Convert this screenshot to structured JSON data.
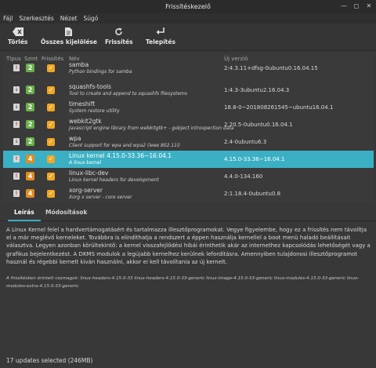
{
  "window": {
    "title": "Frissítéskezelő"
  },
  "menu": [
    "Fájl",
    "Szerkesztés",
    "Nézet",
    "Súgó"
  ],
  "toolbar": {
    "clear": "Törlés",
    "select_all": "Összes kijelölése",
    "refresh": "Frissítés",
    "install": "Telepítés"
  },
  "table": {
    "headers": {
      "type": "Típus",
      "level": "Szint",
      "update": "Frissítés",
      "name": "Név",
      "new_version": "Új verzió"
    },
    "rows": [
      {
        "type": "security",
        "level": "2",
        "checked": true,
        "name": "samba",
        "desc": "Python bindings for samba",
        "version": "2:4.3.11+dfsg-0ubuntu0.16.04.15",
        "selected": false
      },
      {
        "type": "package",
        "level": "2",
        "checked": true,
        "name": "squashfs-tools",
        "desc": "Tool to create and append to squashfs filesystems",
        "version": "1:4.3-3ubuntu2.16.04.3",
        "selected": false
      },
      {
        "type": "package",
        "level": "2",
        "checked": true,
        "name": "timeshift",
        "desc": "System restore utility",
        "version": "18.8-0~201808261545~ubuntu16.04.1",
        "selected": false
      },
      {
        "type": "security",
        "level": "2",
        "checked": true,
        "name": "webkit2gtk",
        "desc": "Javascript engine library from webkitgtk+ - gobject introspection data",
        "version": "2.20.5-0ubuntu0.16.04.1",
        "selected": false
      },
      {
        "type": "package",
        "level": "2",
        "checked": true,
        "name": "wpa",
        "desc": "Client support for wpa and wpa2 (ieee 802.11i)",
        "version": "2.4-0ubuntu6.3",
        "selected": false
      },
      {
        "type": "security",
        "level": "4",
        "checked": true,
        "name": "Linux kernel 4.15.0-33.36~16.04.1",
        "desc": "A linux kernel",
        "version": "4.15.0-33.36~16.04.1",
        "selected": true
      },
      {
        "type": "security",
        "level": "4",
        "checked": true,
        "name": "linux-libc-dev",
        "desc": "Linux kernel headers for development",
        "version": "4.4.0-134.160",
        "selected": false
      },
      {
        "type": "security",
        "level": "4",
        "checked": true,
        "name": "xorg-server",
        "desc": "Xorg x server - core server",
        "version": "2:1.18.4-0ubuntu0.8",
        "selected": false
      }
    ]
  },
  "tabs": {
    "description": "Leírás",
    "changes": "Módosítások"
  },
  "description": "A Linux Kernel felel a hardvertámogatásért és tartalmazza illesztőprogramokat. Vegye figyelembe, hogy ez a frissítés nem távolítja el a már meglévő kerneleket. Továbbra is elindíthatja a rendszert a éppen használja kernellel a boot menü haladó beállításait választva. Legyen azonban körültekintő: a kernel visszafejlődési hibái érinthetik akár az internethez kapcsolódás lehetőségét vagy a grafikus bejelentkezést. A DKMS modulok a legújabb kernelhez kerülnek lefordításra. Amennyiben tulajdonosi illesztőprogramot használ és régebbi kernelt kíván használni, akkor ei kell távolítania az új kernelt.",
  "affected_packages": "A frissítésben érintett csomagok: linux-headers-4.15.0-33 linux-headers-4.15.0-33-generic linux-image-4.15.0-33-generic linux-modules-4.15.0-33-generic linux-modules-extra-4.15.0-33-generic",
  "status": "17 updates selected (246MB)",
  "colors": {
    "accent": "#3bb0c4",
    "level2": "#6ab04c",
    "level4": "#e58a1f",
    "checkbox": "#f2a622"
  }
}
